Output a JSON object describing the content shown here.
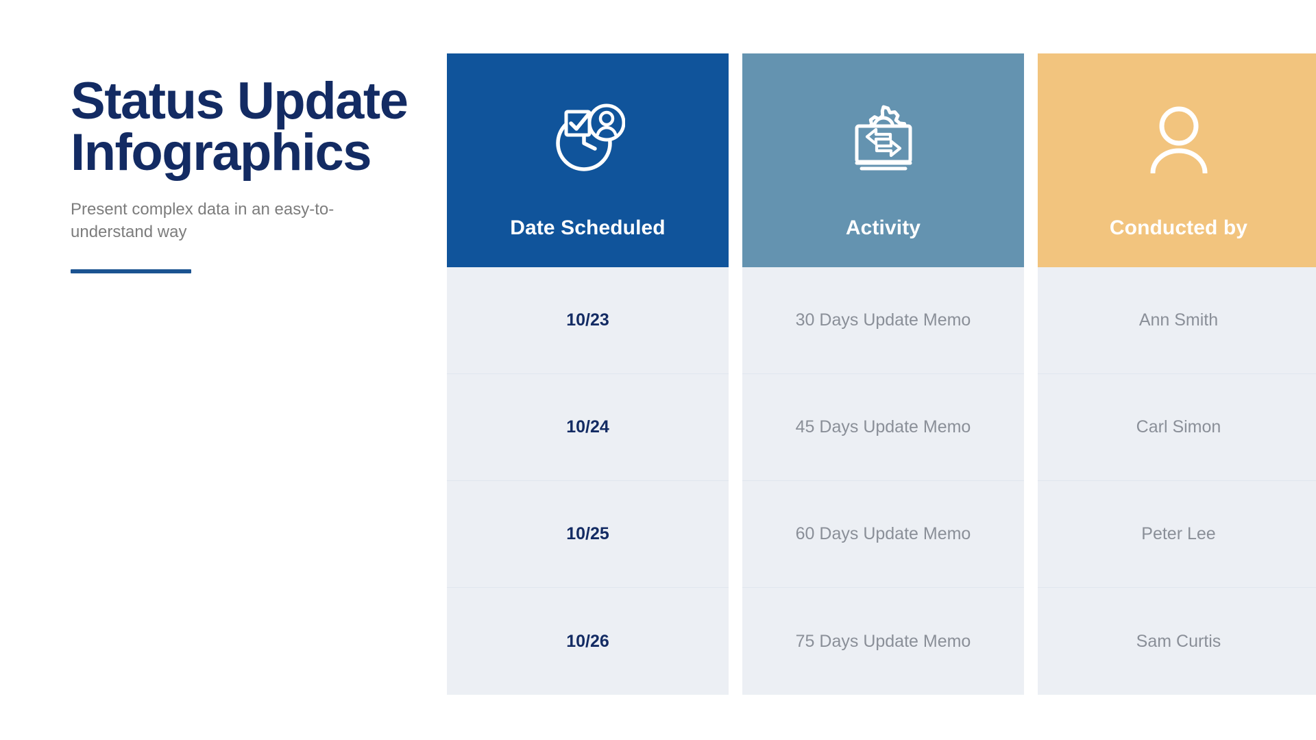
{
  "slide": {
    "title": "Status Update Infographics",
    "subtitle": "Present complex data in an easy-to-understand way"
  },
  "colors": {
    "title_navy": "#132b63",
    "accent_rule": "#1b5391",
    "header_col1": "#10549b",
    "header_col2": "#6493b0",
    "header_col3": "#f2c47e",
    "cell_bg": "#eceff4",
    "cell_text": "#8a8f98",
    "subtitle_gray": "#7c7c7c"
  },
  "table": {
    "columns": [
      {
        "label": "Date Scheduled",
        "icon": "clock-check-person-icon",
        "bg": "#10549b",
        "cells": [
          "10/23",
          "10/24",
          "10/25",
          "10/26"
        ],
        "style": "date"
      },
      {
        "label": "Activity",
        "icon": "monitor-gear-exchange-icon",
        "bg": "#6493b0",
        "cells": [
          "30 Days Update Memo",
          "45 Days Update Memo",
          "60 Days Update Memo",
          "75 Days Update Memo"
        ],
        "style": "text"
      },
      {
        "label": "Conducted by",
        "icon": "person-icon",
        "bg": "#f2c47e",
        "cells": [
          "Ann Smith",
          "Carl Simon",
          "Peter Lee",
          "Sam Curtis"
        ],
        "style": "text"
      }
    ]
  }
}
